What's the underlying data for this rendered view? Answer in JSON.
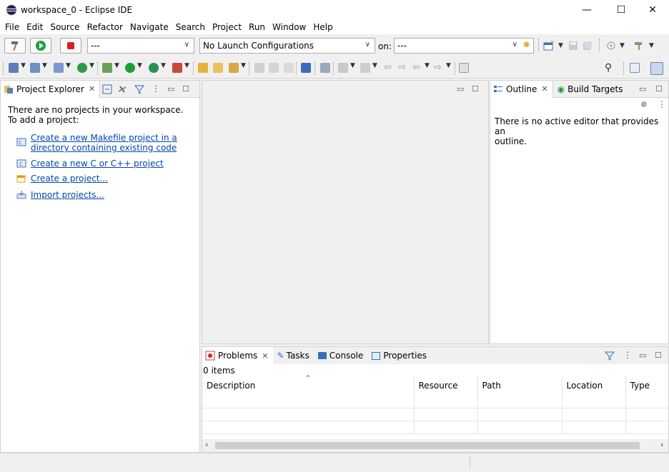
{
  "window": {
    "title": "workspace_0 - Eclipse IDE",
    "controls": {
      "minimize": "—",
      "maximize": "☐",
      "close": "✕"
    }
  },
  "menu": [
    "File",
    "Edit",
    "Source",
    "Refactor",
    "Navigate",
    "Search",
    "Project",
    "Run",
    "Window",
    "Help"
  ],
  "launch_toolbar": {
    "mode_combo": "---",
    "config_combo": "No Launch Configurations",
    "on_label": "on:",
    "target_combo": "---"
  },
  "project_explorer": {
    "tab_label": "Project Explorer",
    "message_line1": "There are no projects in your workspace.",
    "message_line2": "To add a project:",
    "links": [
      {
        "line1": "Create a new Makefile project in a",
        "line2": "directory containing existing code",
        "icon": "makefile-project-icon"
      },
      {
        "line1": "Create a new C or C++ project",
        "icon": "c-project-icon"
      },
      {
        "line1": "Create a project...",
        "icon": "new-project-icon"
      },
      {
        "line1": "Import projects...",
        "icon": "import-icon"
      }
    ]
  },
  "outline": {
    "tab_label": "Outline",
    "build_targets_label": "Build Targets",
    "message_line1": "There is no active editor that provides an",
    "message_line2": "outline."
  },
  "bottom_panel": {
    "tabs": [
      "Problems",
      "Tasks",
      "Console",
      "Properties"
    ],
    "items_count": "0 items",
    "columns": [
      "Description",
      "Resource",
      "Path",
      "Location",
      "Type"
    ]
  },
  "colors": {
    "accent_green": "#1e9e3a",
    "stop_red": "#d92020",
    "link_blue": "#0645ad",
    "title_icon": "#2c2255"
  }
}
